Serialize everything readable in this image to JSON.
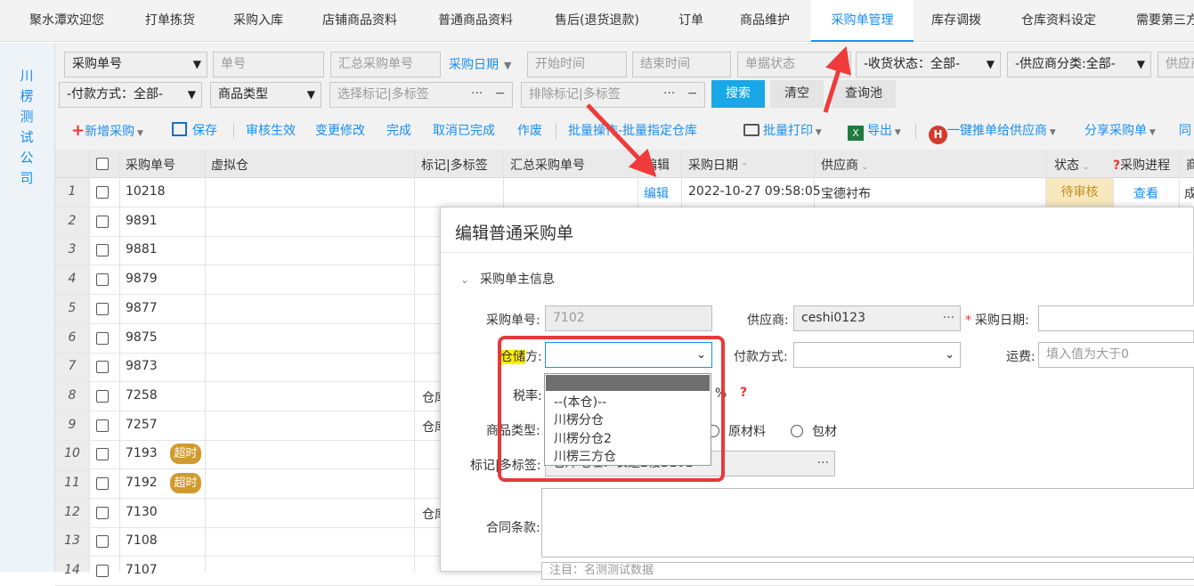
{
  "topnav": {
    "tabs": [
      "聚水潭欢迎您",
      "打单拣货",
      "采购入库",
      "店铺商品资料",
      "普通商品资料",
      "售后(退货退款)",
      "订单",
      "商品维护",
      "采购单管理",
      "库存调拨",
      "仓库资料设定",
      "需要第三方"
    ],
    "active_index": 8
  },
  "leftbar": {
    "company": "川楞测试公司"
  },
  "filters": {
    "po_select": "采购单号",
    "po_input_placeholder": "单号",
    "summary_po_placeholder": "汇总采购单号",
    "date_type": "采购日期",
    "start_placeholder": "开始时间",
    "end_placeholder": "结束时间",
    "status_placeholder": "单据状态",
    "receive_status": "-收货状态：全部-",
    "supplier_category": "-供应商分类:全部-",
    "supplier_partial": "供应商",
    "pay_method": "-付款方式：全部-",
    "goods_type": "商品类型",
    "tag_select_placeholder": "选择标记|多标签",
    "tag_exclude_placeholder": "排除标记|多标签",
    "dots": "···",
    "minus": "−",
    "search_btn": "搜索",
    "clear_btn": "清空",
    "query_pool_btn": "查询池"
  },
  "toolbar": {
    "new_purchase": "新增采购",
    "save": "保存",
    "approve": "审核生效",
    "change": "变更修改",
    "complete": "完成",
    "cancel_complete": "取消已完成",
    "void": "作废",
    "batch_ops": "批量操作-批量指定仓库",
    "batch_print": "批量打印",
    "export": "导出",
    "push_supplier": "一键推单给供应商",
    "share": "分享采购单",
    "more": "同"
  },
  "grid": {
    "headers": {
      "po": "采购单号",
      "virtual_wh": "虚拟仓",
      "tags": "标记|多标签",
      "summary_po": "汇总采购单号",
      "edit": "编辑",
      "date": "采购日期",
      "supplier": "供应商",
      "status": "状态",
      "progress": "采购进程",
      "more": "商"
    },
    "rows": [
      {
        "n": "1",
        "id": "10218",
        "badge": "",
        "wh": "",
        "edit": "编辑",
        "date": "2022-10-27 09:58:05",
        "supplier": "宝德衬布",
        "status": "待审核",
        "view": "查看",
        "last": "成"
      },
      {
        "n": "2",
        "id": "9891",
        "badge": "",
        "wh": ""
      },
      {
        "n": "3",
        "id": "9881",
        "badge": "",
        "wh": ""
      },
      {
        "n": "4",
        "id": "9879",
        "badge": "",
        "wh": ""
      },
      {
        "n": "5",
        "id": "9877",
        "badge": "",
        "wh": ""
      },
      {
        "n": "6",
        "id": "9875",
        "badge": "",
        "wh": ""
      },
      {
        "n": "7",
        "id": "9873",
        "badge": "",
        "wh": ""
      },
      {
        "n": "8",
        "id": "7258",
        "badge": "",
        "wh": "仓库"
      },
      {
        "n": "9",
        "id": "7257",
        "badge": "",
        "wh": "仓库"
      },
      {
        "n": "10",
        "id": "7193",
        "badge": "超时",
        "wh": ""
      },
      {
        "n": "11",
        "id": "7192",
        "badge": "超时",
        "wh": ""
      },
      {
        "n": "12",
        "id": "7130",
        "badge": "",
        "wh": "仓库"
      },
      {
        "n": "13",
        "id": "7108",
        "badge": "",
        "wh": ""
      },
      {
        "n": "14",
        "id": "7107",
        "badge": "",
        "wh": ""
      }
    ]
  },
  "dialog": {
    "title": "编辑普通采购单",
    "section": "采购单主信息",
    "po_label": "采购单号:",
    "po_value": "7102",
    "supplier_label": "供应商:",
    "supplier_value": "ceshi0123",
    "date_label": "采购日期:",
    "required_mark": "*",
    "storage_label_hl": "仓储",
    "storage_label_rest": "方:",
    "pay_label": "付款方式:",
    "freight_label": "运费:",
    "freight_placeholder": "填入值为大于0",
    "tax_label": "税率:",
    "tax_unit": "%",
    "help_mark": "?",
    "goods_type_label": "商品类型:",
    "radio_raw": "原材料",
    "radio_pack": "包材",
    "tags_label": "标记|多标签:",
    "tags_value": "仓库地址：长途2楼B101",
    "contract_label": "合同条款:",
    "bottom_text": "注目：名测测试数据"
  },
  "dropdown": {
    "options": [
      "",
      "--(本仓)--",
      "川楞分仓",
      "川楞分仓2",
      "川楞三方仓"
    ]
  }
}
